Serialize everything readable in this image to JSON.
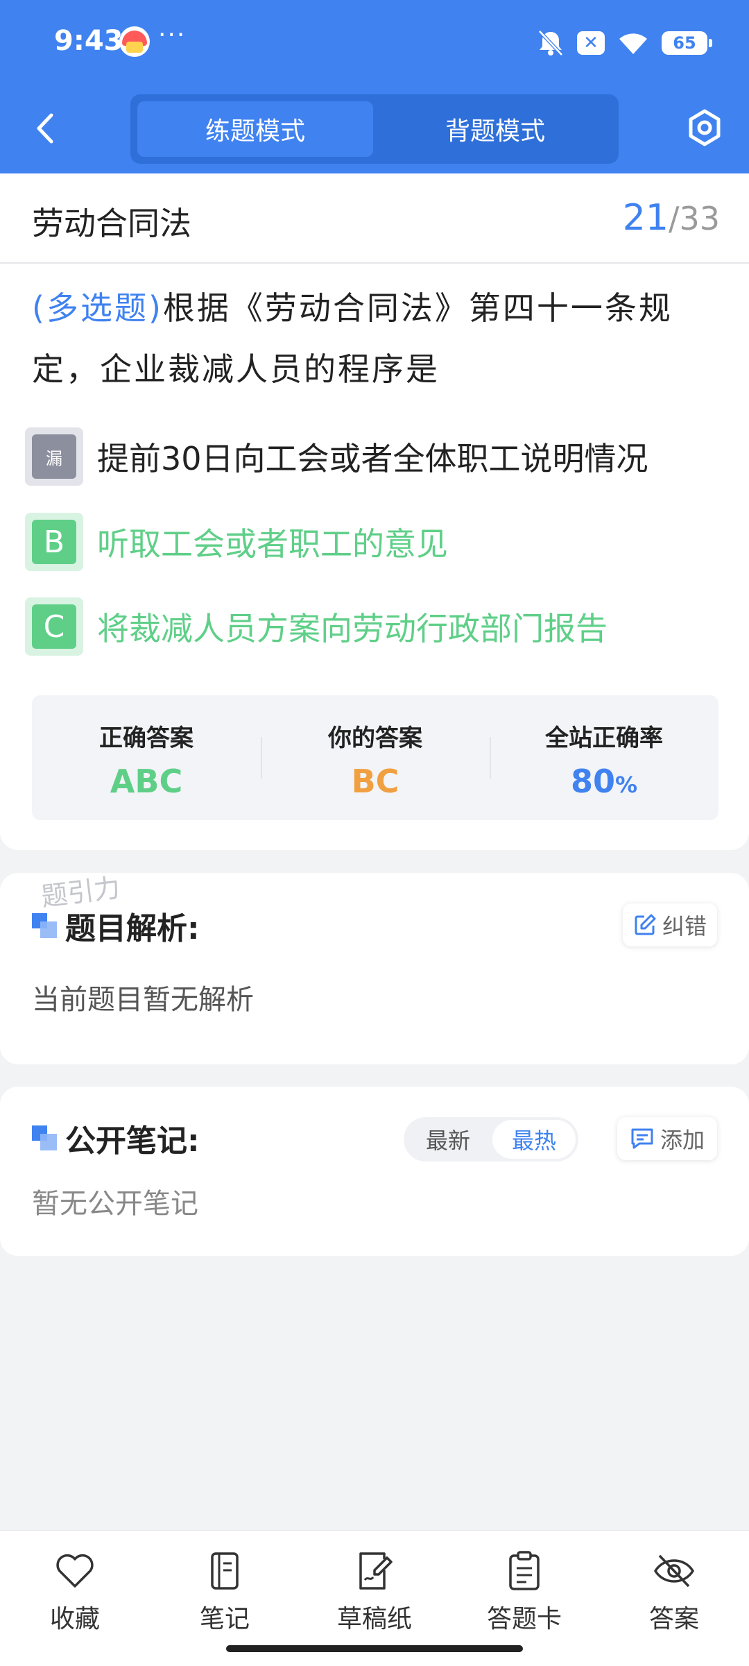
{
  "status_bar": {
    "time": "9:43",
    "more": "···",
    "battery": "65"
  },
  "header": {
    "tabs": [
      {
        "label": "练题模式",
        "active": true
      },
      {
        "label": "背题模式",
        "active": false
      }
    ]
  },
  "question": {
    "subject": "劳动合同法",
    "current": "21",
    "separator": "/",
    "total": "33",
    "type_label": "(多选题)",
    "text": "根据《劳动合同法》第四十一条规定，企业裁减人员的程序是",
    "options": [
      {
        "badge": "漏",
        "text": "提前30日向工会或者全体职工说明情况",
        "state": "missed"
      },
      {
        "badge": "B",
        "text": "听取工会或者职工的意见",
        "state": "correct"
      },
      {
        "badge": "C",
        "text": "将裁减人员方案向劳动行政部门报告",
        "state": "correct"
      }
    ]
  },
  "stats": {
    "correct_label": "正确答案",
    "correct_value": "ABC",
    "yours_label": "你的答案",
    "yours_value": "BC",
    "rate_label": "全站正确率",
    "rate_value": "80",
    "rate_unit": "%"
  },
  "analysis": {
    "watermark": "题引力",
    "title": "题目解析:",
    "correct_btn": "纠错",
    "body": "当前题目暂无解析"
  },
  "notes": {
    "title": "公开笔记:",
    "sort_latest": "最新",
    "sort_hot": "最热",
    "add_btn": "添加",
    "body": "暂无公开笔记"
  },
  "bottom_nav": [
    {
      "label": "收藏",
      "icon": "heart-icon"
    },
    {
      "label": "笔记",
      "icon": "notebook-icon"
    },
    {
      "label": "草稿纸",
      "icon": "draft-icon"
    },
    {
      "label": "答题卡",
      "icon": "answer-card-icon"
    },
    {
      "label": "答案",
      "icon": "eye-off-icon"
    }
  ],
  "colors": {
    "primary": "#3f82f0",
    "correct": "#5fcf88",
    "yours": "#f0a040",
    "missed": "#8c8f9e"
  }
}
